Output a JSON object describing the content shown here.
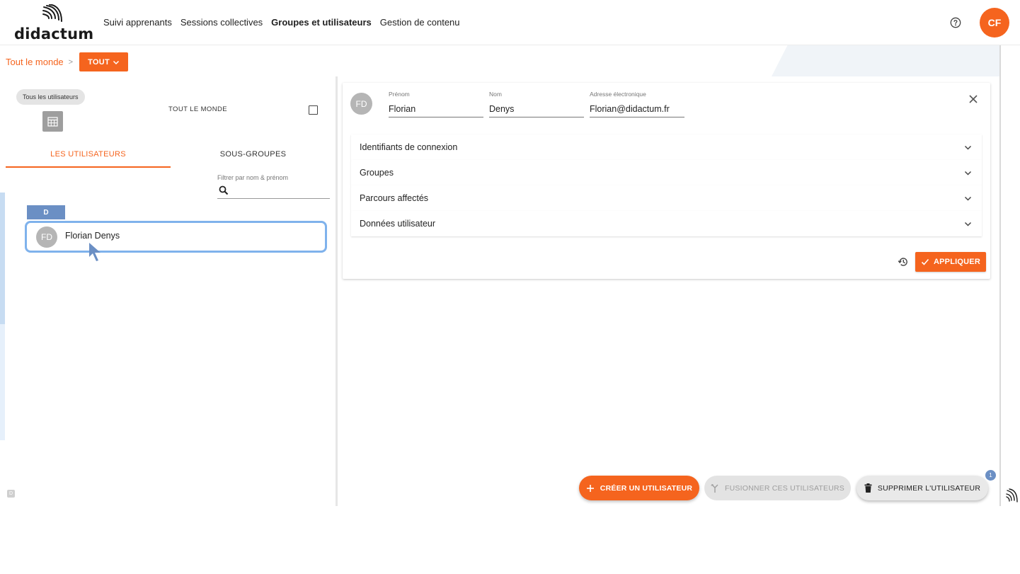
{
  "app": {
    "logo_text": "didactum",
    "nav": [
      {
        "label": "Suivi apprenants"
      },
      {
        "label": "Sessions collectives"
      },
      {
        "label": "Groupes et utilisateurs"
      },
      {
        "label": "Gestion de contenu"
      }
    ],
    "user_initials": "CF",
    "help_icon": "help-circle-icon",
    "accent_color": "#f5641e"
  },
  "breadcrumb": {
    "root": "Tout le monde",
    "separator": ">",
    "current": "TOUT"
  },
  "left": {
    "chip": "Tous les utilisateurs",
    "group_name": "TOUT LE MONDE",
    "tabs": [
      {
        "label": "LES UTILISATEURS"
      },
      {
        "label": "SOUS-GROUPES"
      }
    ],
    "filter_label": "Filtrer par nom & prénom",
    "filter_value": "",
    "letter": "D",
    "users": [
      {
        "initials": "FD",
        "name": "Florian Denys"
      }
    ],
    "small_badge": "D"
  },
  "detail": {
    "initials": "FD",
    "fields": {
      "first_name_label": "Prénom",
      "first_name": "Florian",
      "last_name_label": "Nom",
      "last_name": "Denys",
      "email_label": "Adresse électronique",
      "email": "Florian@didactum.fr"
    },
    "sections": [
      {
        "label": "Identifiants de connexion"
      },
      {
        "label": "Groupes"
      },
      {
        "label": "Parcours affectés"
      },
      {
        "label": "Données utilisateur"
      }
    ],
    "apply_label": "APPLIQUER"
  },
  "actions": {
    "create": "CRÉER UN UTILISATEUR",
    "merge": "FUSIONNER CES UTILISATEURS",
    "delete": "SUPPRIMER L'UTILISATEUR",
    "badge_count": "1"
  }
}
